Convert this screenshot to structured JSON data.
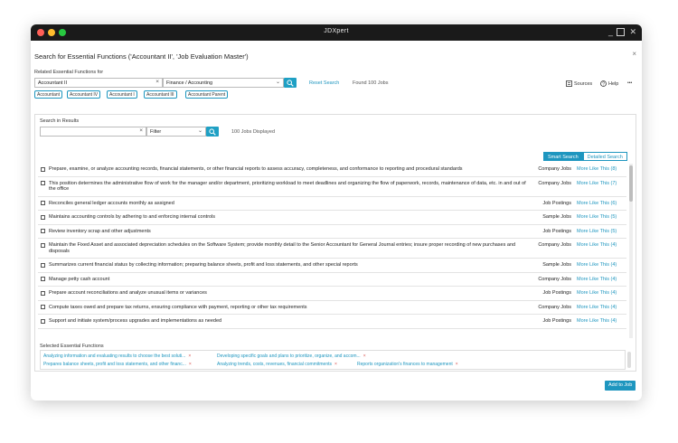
{
  "window": {
    "app_title": "JDXpert"
  },
  "dialog": {
    "title": "Search for Essential Functions ('Accountant II', 'Job Evaluation Master')",
    "close_glyph": "×"
  },
  "related": {
    "label": "Related Essential Functions for",
    "job_value": "Accountant II",
    "category_value": "Finance / Accounting",
    "reset_label": "Reset Search",
    "found_text": "Found 100 Jobs",
    "chips": [
      "Accountant",
      "Accountant IV",
      "Accountant I",
      "Accountant III",
      "Accountant Parent"
    ]
  },
  "toolbar": {
    "sources_label": "Sources",
    "help_label": "Help",
    "more_glyph": "•••"
  },
  "results": {
    "search_label": "Search in Results",
    "search_value": "",
    "filter_value": "Filter",
    "displayed_text": "100 Jobs Displayed",
    "toggle": {
      "smart": "Smart Search",
      "detailed": "Detailed Search"
    },
    "rows": [
      {
        "text": "Prepare, examine, or analyze accounting records, financial statements, or other financial reports to assess accuracy, completeness, and conformance to reporting and procedural standards",
        "source": "Company Jobs",
        "more": "More Like This (8)"
      },
      {
        "text": "This position determines the administrative flow of work for the manager and/or department, prioritizing workload to meet deadlines and organizing the flow of paperwork, records, maintenance of data, etc. in and out of the office",
        "source": "Company Jobs",
        "more": "More Like This (7)"
      },
      {
        "text": "Reconciles general ledger accounts monthly as assigned",
        "source": "Job Postings",
        "more": "More Like This (6)"
      },
      {
        "text": "Maintains accounting controls by adhering to and enforcing internal controls",
        "source": "Sample Jobs",
        "more": "More Like This (5)"
      },
      {
        "text": "Review inventory scrap and other adjustments",
        "source": "Job Postings",
        "more": "More Like This (5)"
      },
      {
        "text": "Maintain the Fixed Asset and associated depreciation schedules on the Software System; provide monthly detail to the Senior Accountant for General Journal entries; insure proper recording of new purchases and disposals",
        "source": "Company Jobs",
        "more": "More Like This (4)"
      },
      {
        "text": "Summarizes current financial status by collecting information; preparing balance sheets, profit and loss statements, and other special reports",
        "source": "Sample Jobs",
        "more": "More Like This (4)"
      },
      {
        "text": "Manage petty cash account",
        "source": "Company Jobs",
        "more": "More Like This (4)"
      },
      {
        "text": "Prepare account reconciliations and analyze unusual items or variances",
        "source": "Job Postings",
        "more": "More Like This (4)"
      },
      {
        "text": "Compute taxes owed and prepare tax returns, ensuring compliance with payment, reporting or other tax requirements",
        "source": "Company Jobs",
        "more": "More Like This (4)"
      },
      {
        "text": "Support and initiate system/process upgrades and implementations as needed",
        "source": "Job Postings",
        "more": "More Like This (4)"
      }
    ]
  },
  "selected": {
    "title": "Selected Essential Functions",
    "remove_glyph": "×",
    "items": [
      "Analyzing information and evaluating results to choose the best soluti...",
      "Developing specific goals and plans to prioritize, organize, and accom...",
      "Prepares balance sheets, profit and loss statements, and other financ...",
      "Analyzing trends, costs, revenues, financial commitments",
      "Reports organization's finances to management"
    ]
  },
  "actions": {
    "add_label": "Add to Job"
  },
  "colors": {
    "accent": "#1e96bf",
    "button": "#1fa0c4",
    "remove": "#d9534f"
  }
}
